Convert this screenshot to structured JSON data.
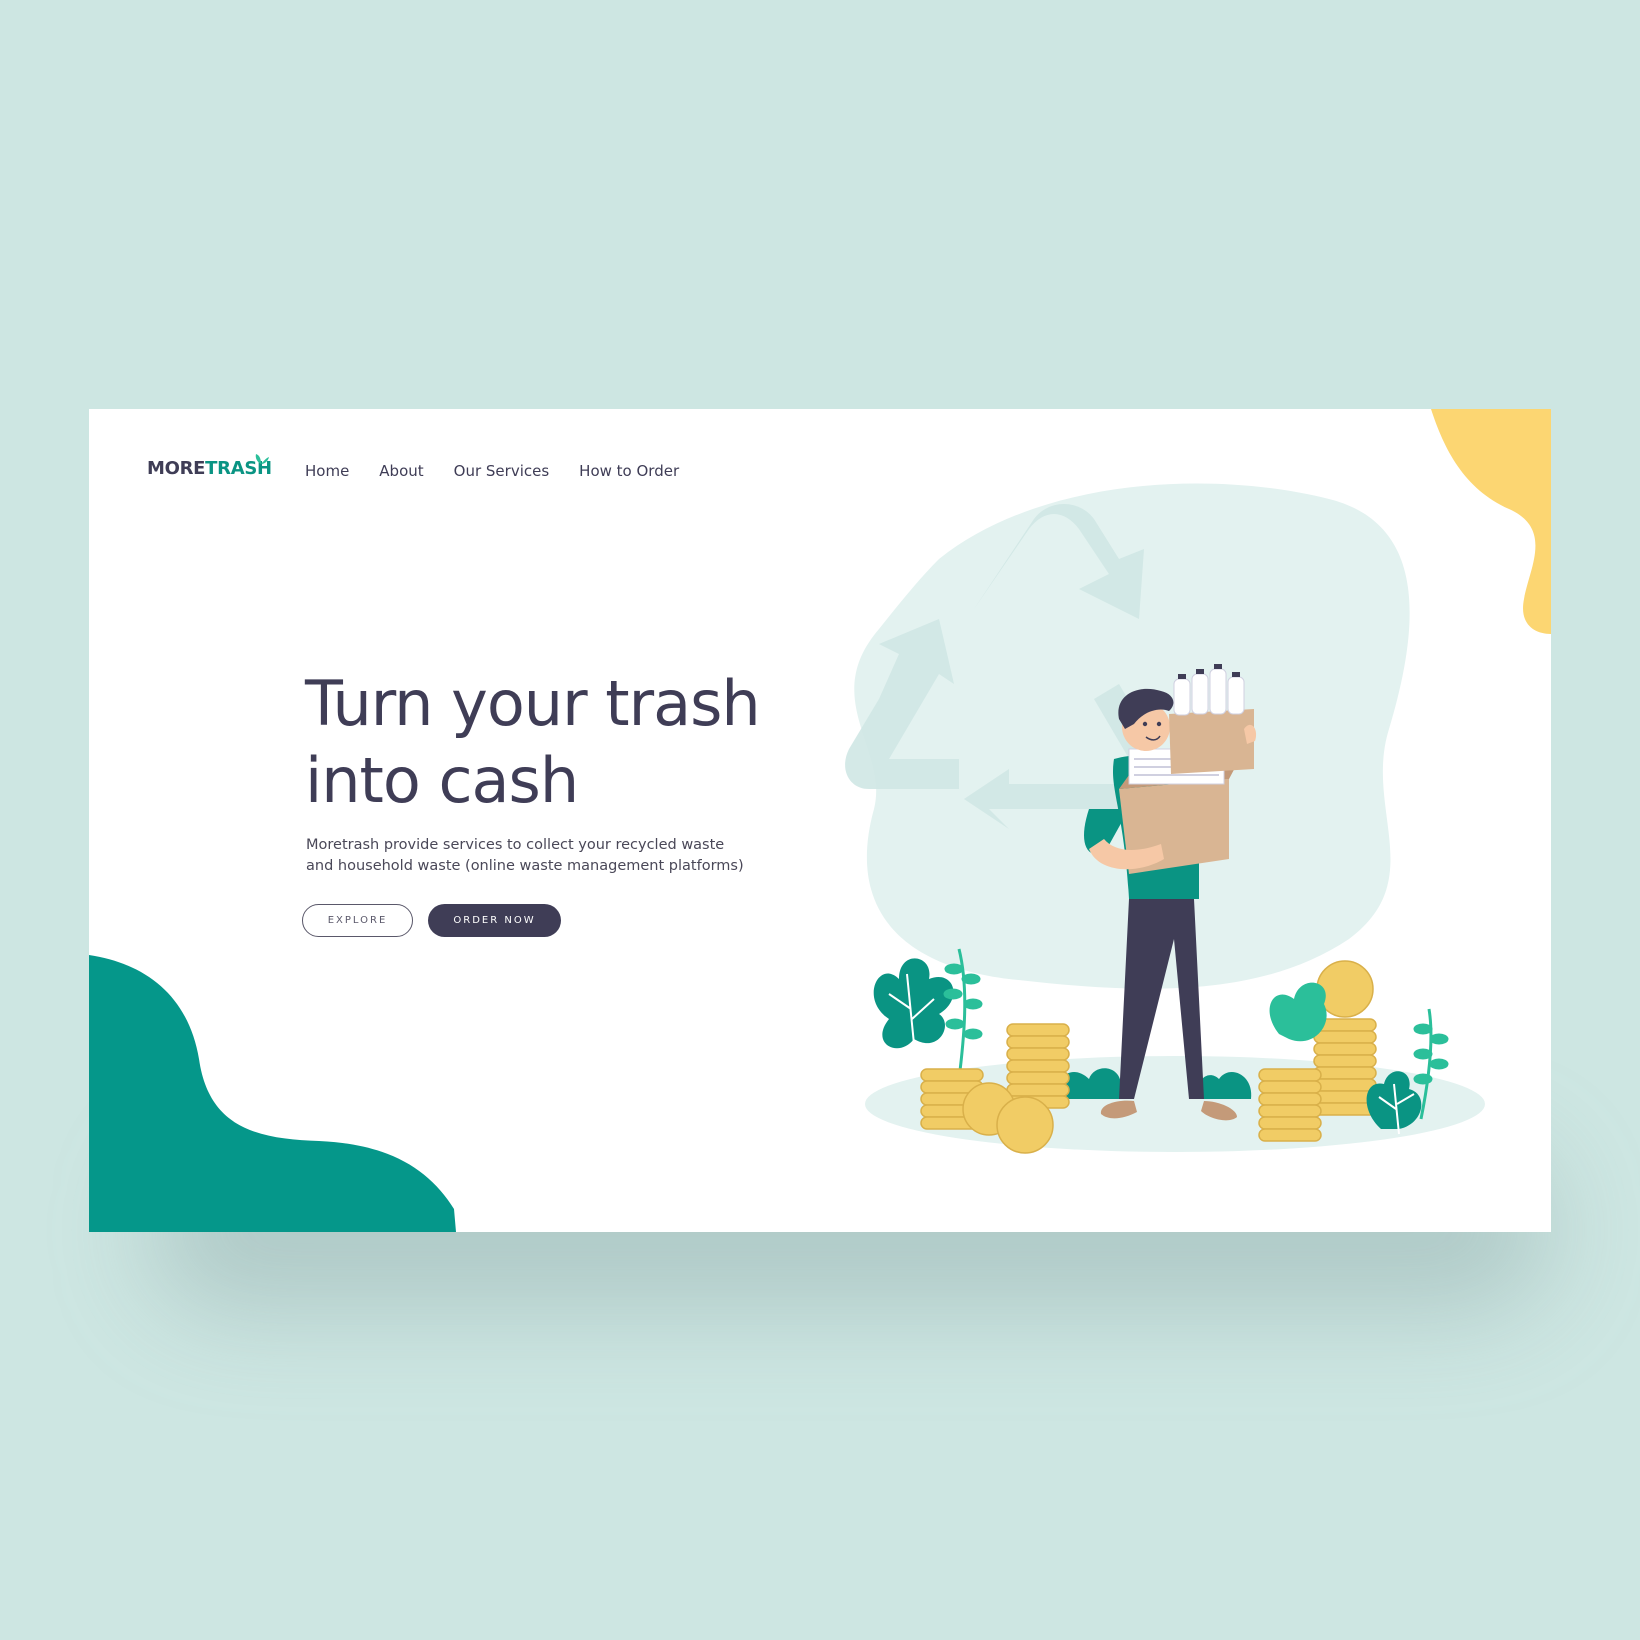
{
  "brand": {
    "name_part1": "MORE",
    "name_part2": "TRASH",
    "colors": {
      "dark": "#3f3d56",
      "accent": "#0a9483",
      "yellow": "#fcd672",
      "background": "#cde6e2"
    }
  },
  "nav": {
    "items": [
      {
        "label": "Home"
      },
      {
        "label": "About"
      },
      {
        "label": "Our Services"
      },
      {
        "label": "How to Order"
      }
    ]
  },
  "hero": {
    "title_line1": "Turn your trash",
    "title_line2": "into cash",
    "description": "Moretrash provide services to collect your recycled waste and household waste (online waste management platforms)",
    "explore_label": "EXPLORE",
    "order_label": "ORDER NOW"
  },
  "illustration": {
    "icons": [
      "recycle-icon",
      "person-carrying-boxes",
      "coin-stack-icon",
      "leaf-icon",
      "bottle-icon"
    ]
  }
}
